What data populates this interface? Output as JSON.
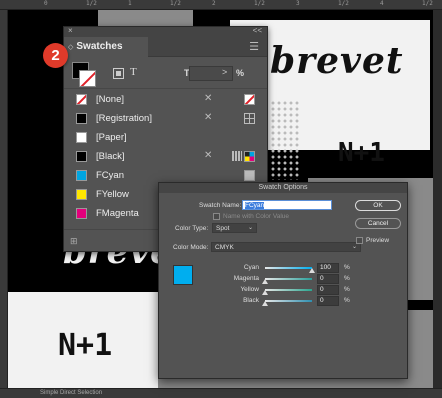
{
  "ruler": {
    "ticks": [
      "0",
      "1/2",
      "1",
      "1/2",
      "2",
      "1/2",
      "3",
      "1/2",
      "4",
      "1/2"
    ]
  },
  "artwork": {
    "script_top": "brevet",
    "script_bottom": "brevet",
    "block_right": "N+1",
    "block_left": "N+1"
  },
  "status": {
    "text": "Simple Direct Selection"
  },
  "badge": {
    "number": "2"
  },
  "swatches_panel": {
    "close_glyph": "×",
    "collapse_glyph": "<<",
    "tab_arrow": "◇",
    "title": "Swatches",
    "menu_glyph": "☰",
    "text_format_glyph": "T",
    "tint_label": "Tint:",
    "tint_value": "",
    "tint_arrow": ">",
    "tint_unit": "%",
    "footer_icon": "⊞",
    "rows": [
      {
        "name": "[None]",
        "chip": "none",
        "icon1": "✕",
        "icon2": "none"
      },
      {
        "name": "[Registration]",
        "chip": "#000000",
        "icon1": "✕",
        "icon2": "reg"
      },
      {
        "name": "[Paper]",
        "chip": "#ffffff",
        "icon1": "",
        "icon2": ""
      },
      {
        "name": "[Black]",
        "chip": "#000000",
        "icon1": "✕",
        "icon2": "cmyk"
      },
      {
        "name": "FCyan",
        "chip": "#00a5e0",
        "icon1": "",
        "icon2": "spot"
      },
      {
        "name": "FYellow",
        "chip": "#ffe600",
        "icon1": "",
        "icon2": ""
      },
      {
        "name": "FMagenta",
        "chip": "#e4007c",
        "icon1": "",
        "icon2": ""
      }
    ]
  },
  "dialog": {
    "title": "Swatch Options",
    "swatch_name_label": "Swatch Name:",
    "swatch_name_value": "FCyan",
    "name_with_value_label": "Name with Color Value",
    "color_type_label": "Color Type:",
    "color_type_value": "Spot",
    "color_mode_label": "Color Mode:",
    "color_mode_value": "CMYK",
    "ok_label": "OK",
    "cancel_label": "Cancel",
    "preview_label": "Preview",
    "preview_color": "#00aeef",
    "sliders": [
      {
        "label": "Cyan",
        "value": "100",
        "fraction": 1.0,
        "track": "#00aeef"
      },
      {
        "label": "Magenta",
        "value": "0",
        "fraction": 0.0,
        "track": "#2a9f9a"
      },
      {
        "label": "Yellow",
        "value": "0",
        "fraction": 0.0,
        "track": "#2aa58f"
      },
      {
        "label": "Black",
        "value": "0",
        "fraction": 0.0,
        "track": "#2f8fb0"
      }
    ],
    "percent": "%"
  }
}
